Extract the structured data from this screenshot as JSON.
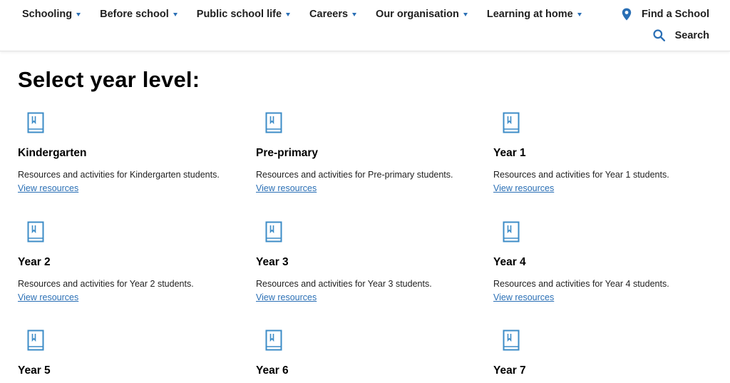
{
  "nav": {
    "items": [
      {
        "label": "Schooling"
      },
      {
        "label": "Before school"
      },
      {
        "label": "Public school life"
      },
      {
        "label": "Careers"
      },
      {
        "label": "Our organisation"
      },
      {
        "label": "Learning at home"
      }
    ],
    "find_school": "Find a School",
    "search": "Search"
  },
  "colors": {
    "accent": "#2a6fb5",
    "icon": "#3d8cc7"
  },
  "page": {
    "heading": "Select year level:"
  },
  "cards": [
    {
      "title": "Kindergarten",
      "desc": "Resources and activities for Kindergarten students.",
      "link": "View resources",
      "icon": "book-icon"
    },
    {
      "title": "Pre-primary",
      "desc": "Resources and activities for Pre-primary students.",
      "link": "View resources",
      "icon": "book-icon"
    },
    {
      "title": "Year 1",
      "desc": "Resources and activities for Year 1 students.",
      "link": "View resources",
      "icon": "book-icon"
    },
    {
      "title": "Year 2",
      "desc": "Resources and activities for Year 2 students.",
      "link": "View resources",
      "icon": "book-icon"
    },
    {
      "title": "Year 3",
      "desc": "Resources and activities for Year 3 students.",
      "link": "View resources",
      "icon": "book-icon"
    },
    {
      "title": "Year 4",
      "desc": "Resources and activities for Year 4 students.",
      "link": "View resources",
      "icon": "book-icon"
    },
    {
      "title": "Year 5",
      "icon": "book-icon"
    },
    {
      "title": "Year 6",
      "icon": "book-icon"
    },
    {
      "title": "Year 7",
      "icon": "book-icon"
    }
  ]
}
